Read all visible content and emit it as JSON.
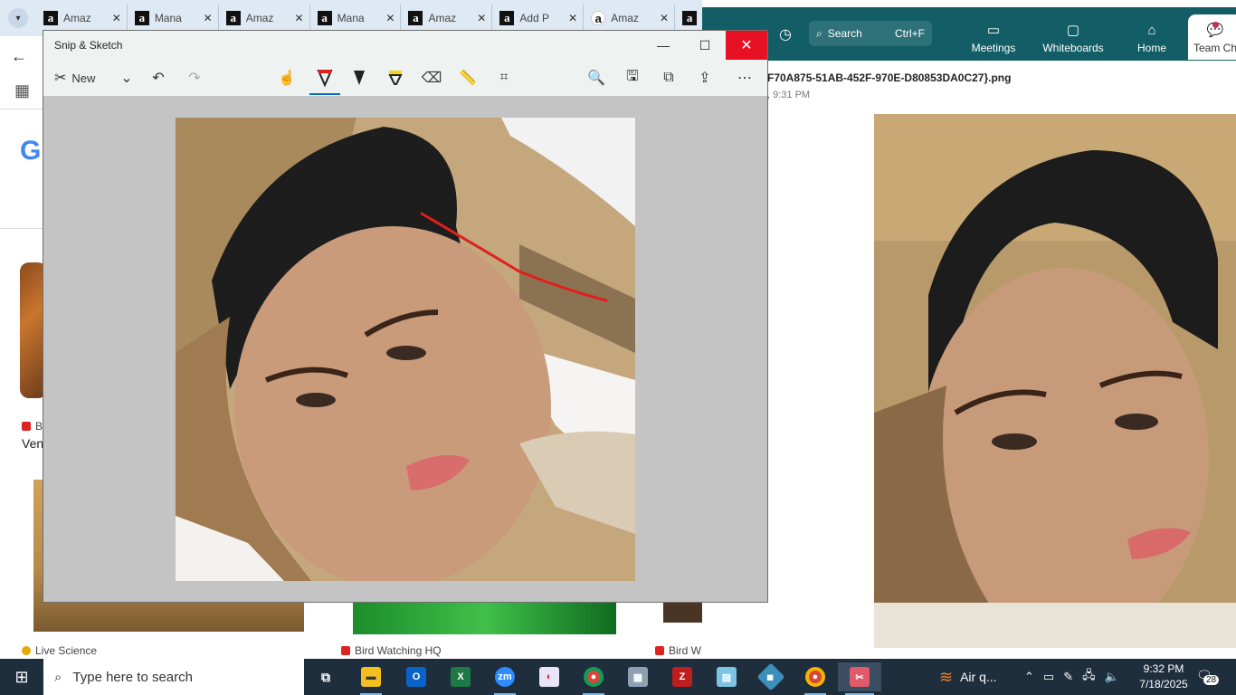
{
  "browser": {
    "tabs": [
      {
        "label": "Amaz",
        "icon": "amazon-a-icon"
      },
      {
        "label": "Mana",
        "icon": "amazon-a-icon"
      },
      {
        "label": "Amaz",
        "icon": "amazon-a-icon"
      },
      {
        "label": "Mana",
        "icon": "amazon-a-icon"
      },
      {
        "label": "Amaz",
        "icon": "amazon-a-icon"
      },
      {
        "label": "Add P",
        "icon": "amazon-a-icon"
      },
      {
        "label": "Amaz",
        "icon": "amazon-smile-icon"
      }
    ],
    "page": {
      "logo_letter": "G",
      "results": [
        {
          "source_left": "B",
          "title_left": "Ven"
        },
        {
          "source": "Live Science"
        },
        {
          "source": "Bird Watching HQ"
        },
        {
          "source": "Bird W"
        }
      ]
    }
  },
  "snip": {
    "title": "Snip & Sketch",
    "new_label": "New",
    "tools": [
      "touch-writing-icon",
      "ballpoint-pen-icon",
      "pencil-icon",
      "highlighter-icon",
      "eraser-icon",
      "ruler-icon",
      "crop-icon"
    ],
    "selected_tool": "ballpoint-pen-icon",
    "pen_color": "#e0201c",
    "actions": [
      "zoom-icon",
      "save-icon",
      "copy-icon",
      "share-icon",
      "more-icon"
    ]
  },
  "teams": {
    "search_label": "Search",
    "search_shortcut": "Ctrl+F",
    "apps": [
      {
        "label": "Meetings",
        "icon": "video-camera-icon"
      },
      {
        "label": "Whiteboards",
        "icon": "whiteboard-icon"
      },
      {
        "label": "Home",
        "icon": "home-icon"
      },
      {
        "label": "Team Ch",
        "icon": "chat-icon"
      }
    ],
    "file_name": "F70A875-51AB-452F-970E-D80853DA0C27}.png",
    "file_time": ", 9:31 PM"
  },
  "taskbar": {
    "search_placeholder": "Type here to search",
    "weather": "Air q...",
    "time": "9:32 PM",
    "date": "7/18/2025",
    "notification_count": "28",
    "apps": [
      "task-view-icon",
      "file-explorer-icon",
      "outlook-icon",
      "excel-icon",
      "zoom-icon",
      "paint-icon",
      "chrome-icon",
      "calculator-icon",
      "filezilla-icon",
      "notepad-icon",
      "network-icon",
      "chrome-icon",
      "snip-sketch-icon"
    ]
  }
}
